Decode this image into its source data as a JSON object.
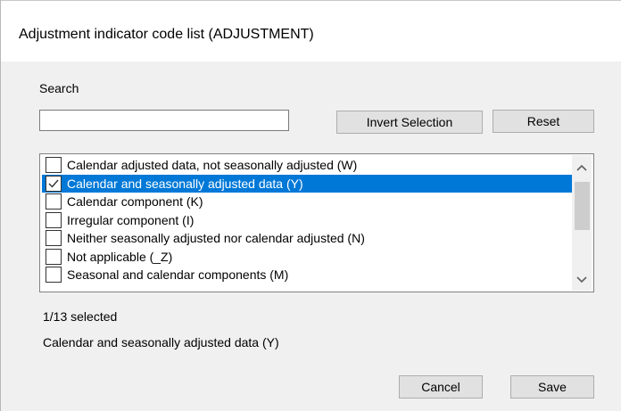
{
  "dialog": {
    "title": "Adjustment indicator code list (ADJUSTMENT)"
  },
  "search": {
    "label": "Search",
    "value": "",
    "placeholder": ""
  },
  "buttons": {
    "invert_selection": "Invert Selection",
    "reset": "Reset",
    "cancel": "Cancel",
    "save": "Save"
  },
  "list": {
    "items": [
      {
        "label": "Calendar adjusted data, not seasonally adjusted (W)",
        "checked": false,
        "selected": false
      },
      {
        "label": "Calendar and seasonally adjusted data (Y)",
        "checked": true,
        "selected": true
      },
      {
        "label": "Calendar component (K)",
        "checked": false,
        "selected": false
      },
      {
        "label": "Irregular component (I)",
        "checked": false,
        "selected": false
      },
      {
        "label": "Neither seasonally adjusted nor calendar adjusted (N)",
        "checked": false,
        "selected": false
      },
      {
        "label": "Not applicable (_Z)",
        "checked": false,
        "selected": false
      },
      {
        "label": "Seasonal and calendar components (M)",
        "checked": false,
        "selected": false
      }
    ]
  },
  "status": {
    "count": "1/13 selected",
    "selected_summary": "Calendar and seasonally adjusted data (Y)"
  },
  "colors": {
    "selection": "#0078d7",
    "window_bg": "#f0f0f0",
    "title_bg": "#ffffff"
  }
}
